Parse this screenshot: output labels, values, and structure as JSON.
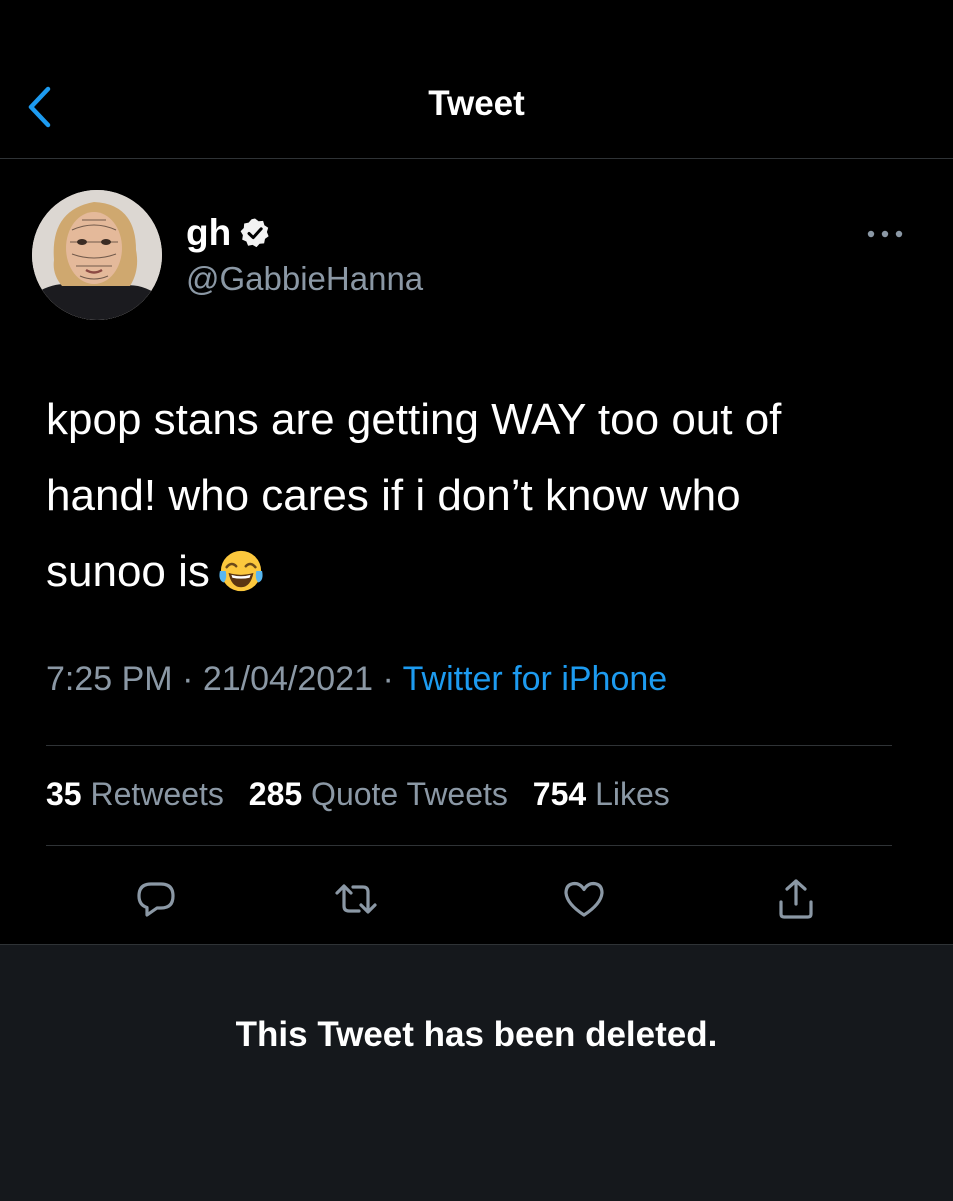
{
  "header": {
    "title": "Tweet"
  },
  "author": {
    "display_name": "gh",
    "handle": "@GabbieHanna",
    "verified": true
  },
  "tweet": {
    "lines": [
      "kpop stans are getting WAY too out of",
      "hand! who cares if i don’t know who",
      "sunoo is"
    ],
    "emoji": "face-with-tears-of-joy",
    "time": "7:25 PM",
    "separator": " · ",
    "date": "21/04/2021",
    "source": "Twitter for iPhone"
  },
  "stats": {
    "retweets_count": "35",
    "retweets_label": "Retweets",
    "quotes_count": "285",
    "quotes_label": "Quote Tweets",
    "likes_count": "754",
    "likes_label": "Likes"
  },
  "deleted_notice": "This Tweet has been deleted.",
  "colors": {
    "background": "#000000",
    "accent": "#1d9bf0",
    "secondary_text": "#8b98a5",
    "divider": "#2f3336",
    "notice_background": "#15181c"
  }
}
